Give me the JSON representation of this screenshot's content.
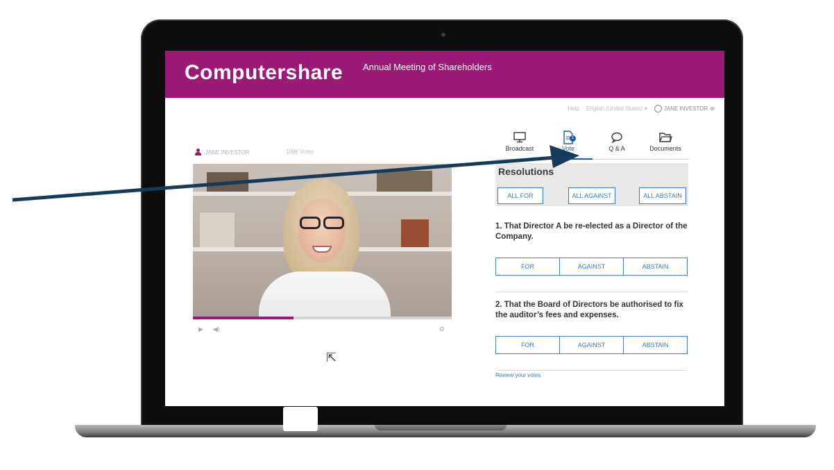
{
  "header": {
    "logo_text": "Computershare",
    "meeting_title": "Annual Meeting of Shareholders"
  },
  "utility": {
    "help": "Help",
    "language": "English (United States) ▾",
    "user": "JANE INVESTOR"
  },
  "video": {
    "presenter": "JANE INVESTOR",
    "votes": "1096 Votes",
    "progress_fraction": 0.39
  },
  "tabs": [
    {
      "label": "Broadcast",
      "icon": "monitor-icon"
    },
    {
      "label": "Vote",
      "icon": "document-icon",
      "badge": "1"
    },
    {
      "label": "Q & A",
      "icon": "chat-bubble-icon"
    },
    {
      "label": "Documents",
      "icon": "folder-icon"
    }
  ],
  "resolutions": {
    "title": "Resolutions",
    "all_for": "ALL FOR",
    "all_against": "ALL AGAINST",
    "all_abstain": "ALL ABSTAIN"
  },
  "questions": [
    {
      "text": "1. That Director A be re-elected as a Director of the Company.",
      "for": "FOR",
      "against": "AGAINST",
      "abstain": "ABSTAIN"
    },
    {
      "text": "2. That the Board of Directors be authorised to fix the auditor’s fees and expenses.",
      "for": "FOR",
      "against": "AGAINST",
      "abstain": "ABSTAIN"
    }
  ],
  "review_link": "Review your votes",
  "colors": {
    "brand": "#9b1a75",
    "accent": "#3a7bbf",
    "arrow": "#163a5a"
  }
}
